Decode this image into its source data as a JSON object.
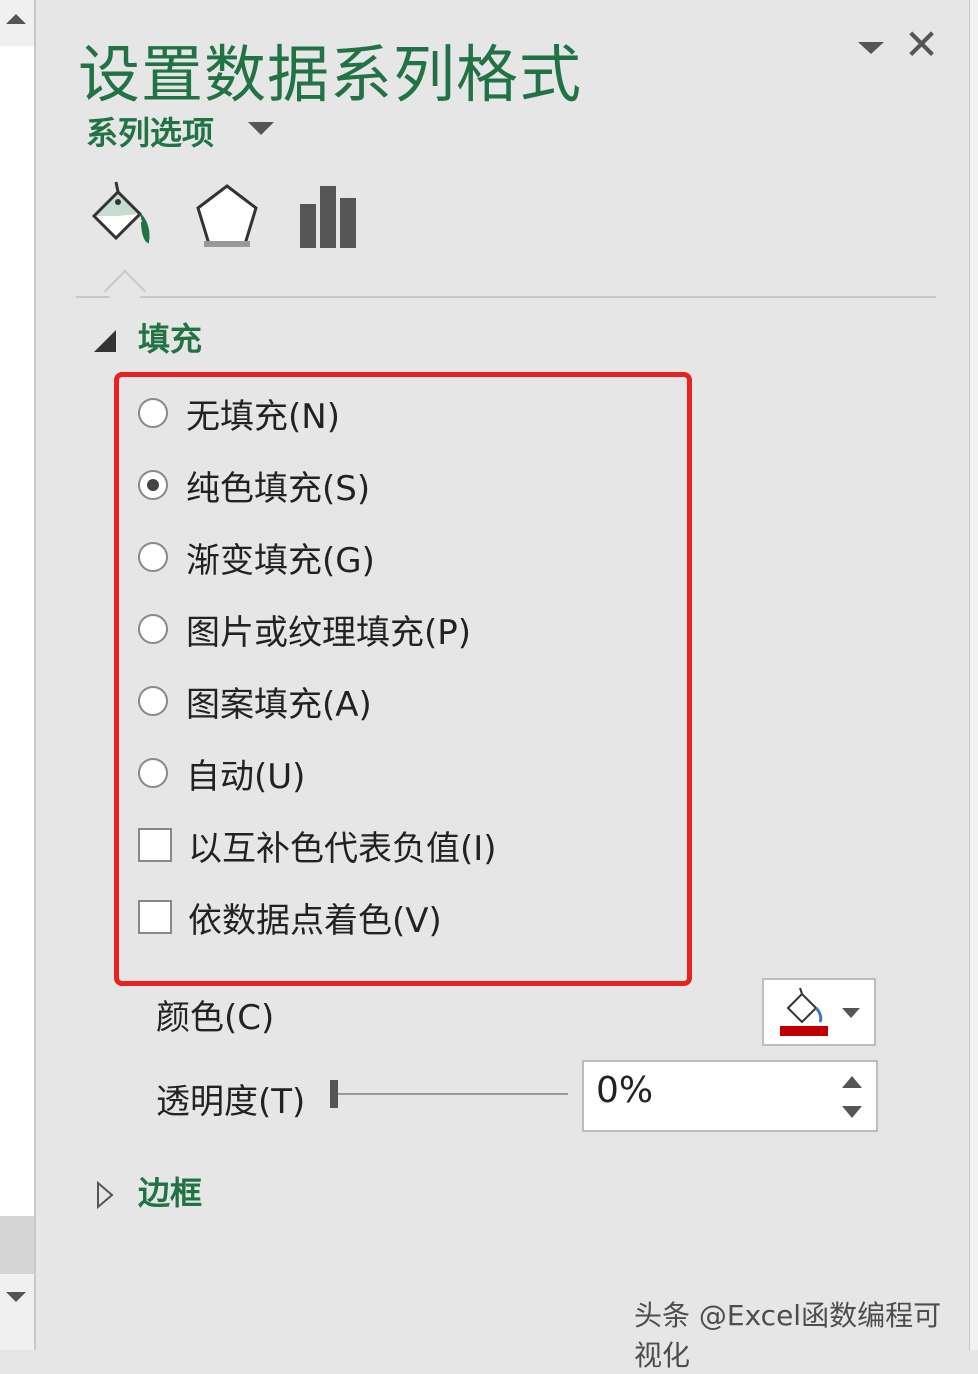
{
  "pane": {
    "title": "设置数据系列格式",
    "series_options_label": "系列选项",
    "tabs": [
      {
        "icon": "fill-line-icon",
        "name": "填充与线条"
      },
      {
        "icon": "effects-pentagon-icon",
        "name": "效果"
      },
      {
        "icon": "series-options-bar-icon",
        "name": "系列选项"
      }
    ]
  },
  "fill_section": {
    "header": "填充",
    "options": [
      {
        "label": "无填充(N)",
        "selected": false
      },
      {
        "label": "纯色填充(S)",
        "selected": true
      },
      {
        "label": "渐变填充(G)",
        "selected": false
      },
      {
        "label": "图片或纹理填充(P)",
        "selected": false
      },
      {
        "label": "图案填充(A)",
        "selected": false
      },
      {
        "label": "自动(U)",
        "selected": false
      }
    ],
    "checkboxes": [
      {
        "label": "以互补色代表负值(I)",
        "checked": false
      },
      {
        "label": "依数据点着色(V)",
        "checked": false
      }
    ],
    "color_label": "颜色(C)",
    "color_swatch": "#c00000",
    "transparency_label": "透明度(T)",
    "transparency_value": "0%"
  },
  "border_section": {
    "header": "边框"
  },
  "highlight_color": "#e8231f",
  "accent_color": "#217346",
  "watermark": "头条 @Excel函数编程可视化"
}
